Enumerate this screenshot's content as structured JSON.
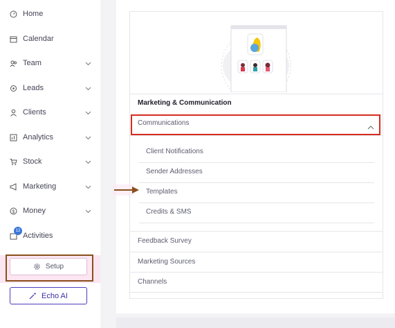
{
  "sidebar": {
    "items": [
      {
        "label": "Home",
        "icon": "home-icon"
      },
      {
        "label": "Calendar",
        "icon": "calendar-icon"
      },
      {
        "label": "Team",
        "icon": "team-icon"
      },
      {
        "label": "Leads",
        "icon": "leads-icon"
      },
      {
        "label": "Clients",
        "icon": "clients-icon"
      },
      {
        "label": "Analytics",
        "icon": "analytics-icon"
      },
      {
        "label": "Stock",
        "icon": "cart-icon"
      },
      {
        "label": "Marketing",
        "icon": "megaphone-icon"
      },
      {
        "label": "Money",
        "icon": "money-icon"
      },
      {
        "label": "Activities",
        "icon": "activities-icon",
        "badge": "12"
      }
    ],
    "setup_label": "Setup",
    "echo_label": "Echo AI"
  },
  "main": {
    "section_title": "Marketing & Communication",
    "communications_label": "Communications",
    "sub_items": [
      "Client Notifications",
      "Sender Addresses",
      "Templates",
      "Credits & SMS"
    ],
    "rows": [
      "Feedback Survey",
      "Marketing Sources",
      "Channels"
    ]
  },
  "colors": {
    "highlight_red": "#d62c20",
    "annotation_brown": "#8a4f1c",
    "accent_purple": "#4b3bbf"
  }
}
